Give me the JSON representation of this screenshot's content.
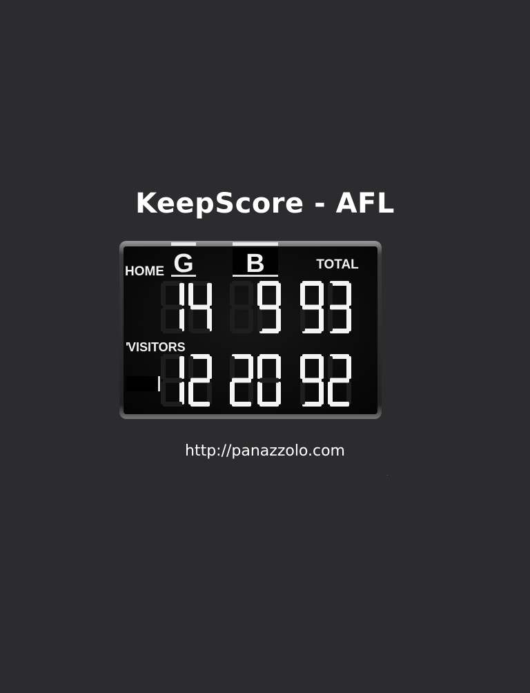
{
  "app": {
    "title": "KeepScore - AFL",
    "link_text": "http://panazzolo.com"
  },
  "scoreboard": {
    "headers": {
      "goals": "G",
      "behinds": "B",
      "total": "TOTAL"
    },
    "home": {
      "label": "HOME",
      "goals": "14",
      "behinds": "9",
      "total": "93"
    },
    "visitors": {
      "label": "VISITORS",
      "goals": "12",
      "behinds": "20",
      "total": "92"
    }
  },
  "colors": {
    "background": "#2c2b2e",
    "board": "#0c0c0c",
    "frame": "#7a7a7a",
    "digit_lit": "#f4f4f4",
    "digit_unlit": "#1e1e1e"
  }
}
